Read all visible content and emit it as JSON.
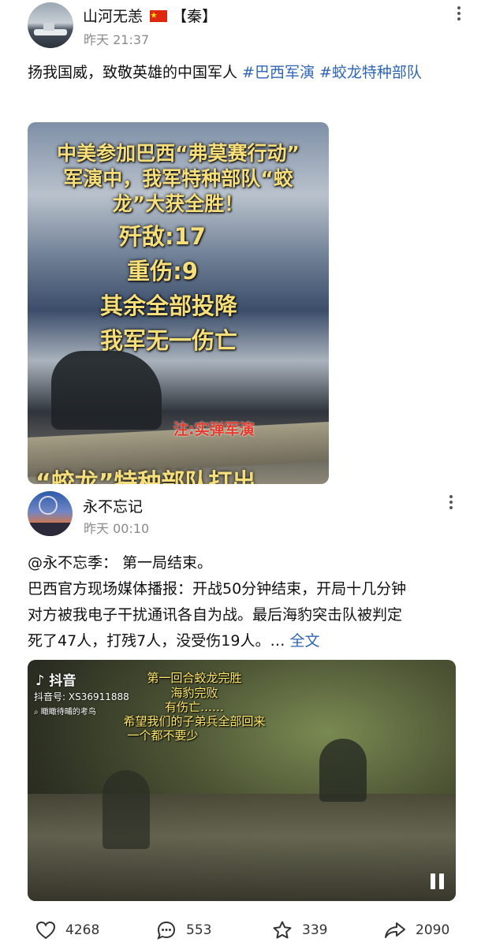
{
  "post1": {
    "username": "山河无恙",
    "flag_icon": "china-flag-icon",
    "tag_suffix": "【秦】",
    "time": "昨天 21:37",
    "text": "扬我国威，致敬英雄的中国军人 ",
    "hashtags": [
      "#巴西军演",
      "#蛟龙特种部队"
    ],
    "image": {
      "lines": [
        "中美参加巴西“弗莫赛行动”",
        "军演中，我军特种部队“蛟",
        "龙”大获全胜！",
        "歼敌:17",
        "重伤:9",
        "其余全部投降",
        "我军无一伤亡"
      ],
      "note": "注:实弹军演",
      "bottom_cut": "“蛟龙”特种部队打出"
    }
  },
  "post2": {
    "username": "永不忘记",
    "time": "昨天 00:10",
    "lines": [
      "@永不忘季：  第一局结束。",
      "巴西官方现场媒体播报：开战50分钟结束，开局十几分钟",
      "对方被我电子干扰通讯各自为战。最后海豹突击队被判定"
    ],
    "last_line": "死了47人，打残7人，没受伤19人。… ",
    "full_text_link": "全文",
    "video": {
      "app_name": "抖音",
      "account_id": "抖音号: XS36911888",
      "search_hint": "瞰瞰待晡的考鸟",
      "captions": [
        "第一回合蛟龙完胜",
        "海豹完败",
        "有伤亡……",
        "希望我们的子弟兵全部回来",
        "一个都不要少"
      ]
    }
  },
  "actions": {
    "likes": "4268",
    "comments": "553",
    "favorites": "339",
    "shares": "2090"
  },
  "colors": {
    "link": "#2f66b3",
    "meta": "#8a8a8a",
    "overlay_text": "#f6df7a",
    "note_red": "#e33a2a",
    "caption_yellow": "#ffe86a"
  }
}
